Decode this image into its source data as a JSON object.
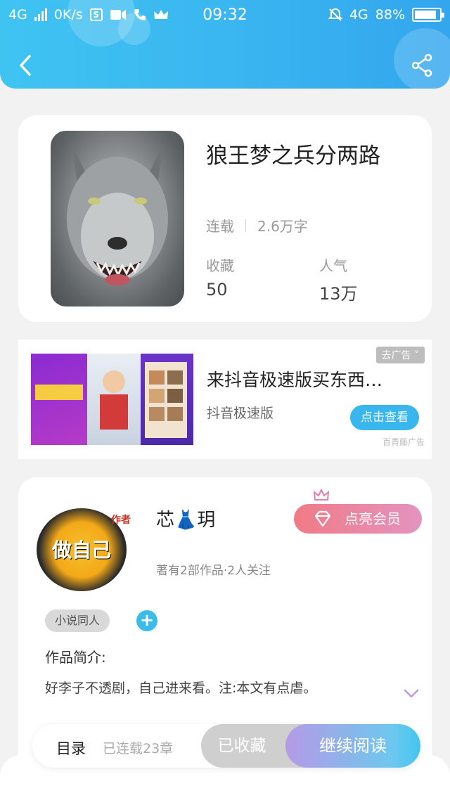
{
  "status_bar": {
    "network": "4G",
    "speed": "0K/s",
    "time": "09:32",
    "network_right": "4G",
    "battery": "88%",
    "battery_level": 0.88
  },
  "book": {
    "title": "狼王梦之兵分两路",
    "status": "连载",
    "word_count": "2.6万字",
    "favorites_label": "收藏",
    "favorites_value": "50",
    "popularity_label": "人气",
    "popularity_value": "13万"
  },
  "ad": {
    "title": "来抖音极速版买东西…",
    "source": "抖音极速版",
    "remove_label": "去广告",
    "cta": "点击查看",
    "tag": "百青藤广告"
  },
  "author": {
    "name": "芯👗玥",
    "stats": "著有2部作品·2人关注",
    "vip_button": "点亮会员",
    "avatar_text": "做自己",
    "avatar_tag": "作者",
    "tag": "小说同人",
    "add_symbol": "+",
    "intro_label": "作品简介:",
    "intro_text": "好李子不透剧，自己进来看。注:本文有点虐。"
  },
  "bottom_bar": {
    "toc_label": "目录",
    "toc_count": "已连载23章",
    "collected_label": "已收藏",
    "read_label": "继续阅读"
  },
  "colors": {
    "header": "#3ab6f0",
    "accent": "#3bbbe9",
    "vip": "#f07b86"
  }
}
